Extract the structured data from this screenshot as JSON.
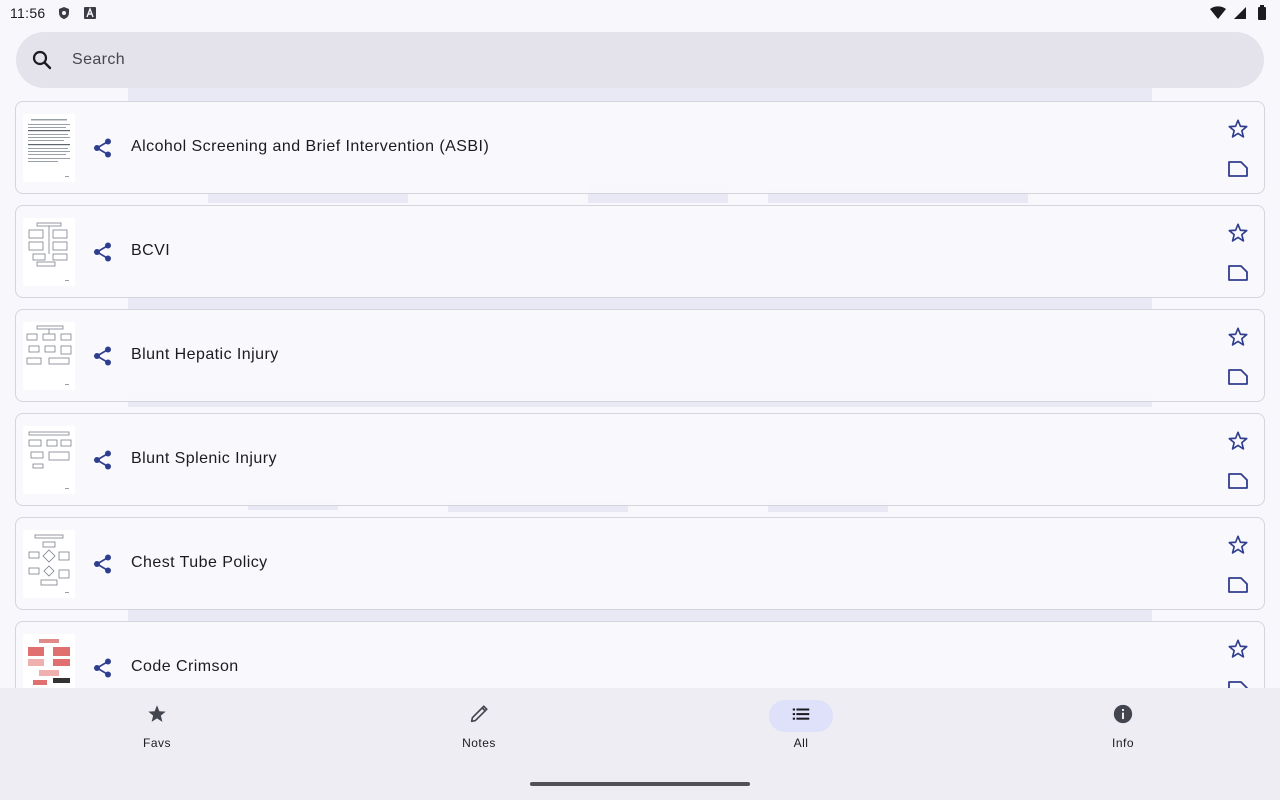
{
  "status_bar": {
    "time": "11:56",
    "left_icons": [
      "shield-icon",
      "a-badge-icon"
    ],
    "right_icons": [
      "wifi-icon",
      "cell-signal-icon",
      "battery-icon"
    ]
  },
  "search": {
    "placeholder": "Search",
    "value": ""
  },
  "documents": [
    {
      "title": "Alcohol Screening and Brief Intervention (ASBI)"
    },
    {
      "title": "BCVI"
    },
    {
      "title": "Blunt Hepatic Injury"
    },
    {
      "title": "Blunt Splenic Injury"
    },
    {
      "title": "Chest Tube Policy"
    },
    {
      "title": "Code Crimson"
    }
  ],
  "bottom_nav": {
    "items": [
      {
        "label": "Favs",
        "icon": "star-icon"
      },
      {
        "label": "Notes",
        "icon": "pencil-icon"
      },
      {
        "label": "All",
        "icon": "list-icon",
        "active": true
      },
      {
        "label": "Info",
        "icon": "info-icon"
      }
    ]
  },
  "colors": {
    "accent": "#2f3e8f",
    "nav_active_pill": "#dfe0f9",
    "search_bg": "#e4e2ea",
    "page_bg": "#f8f7fc"
  }
}
